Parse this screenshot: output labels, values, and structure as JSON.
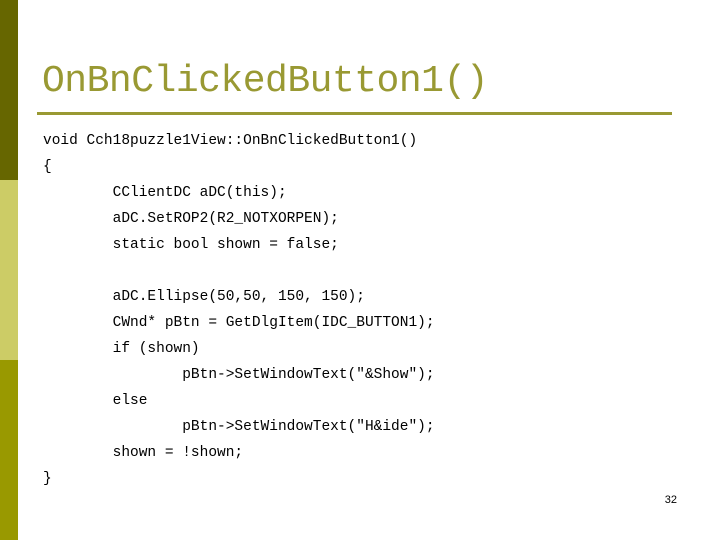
{
  "theme": {
    "sidebar_colors": [
      "#666600",
      "#CCCC66",
      "#999900"
    ],
    "title_color": "#999933",
    "rule_color": "#999933"
  },
  "slide": {
    "title": "OnBnClickedButton1()",
    "code_lines": [
      "void Cch18puzzle1View::OnBnClickedButton1()",
      "{",
      "        CClientDC aDC(this);",
      "        aDC.SetROP2(R2_NOTXORPEN);",
      "        static bool shown = false;",
      "",
      "        aDC.Ellipse(50,50, 150, 150);",
      "        CWnd* pBtn = GetDlgItem(IDC_BUTTON1);",
      "        if (shown)",
      "                pBtn->SetWindowText(\"&Show\");",
      "        else",
      "                pBtn->SetWindowText(\"H&ide\");",
      "        shown = !shown;",
      "}"
    ],
    "page_number": "32"
  }
}
